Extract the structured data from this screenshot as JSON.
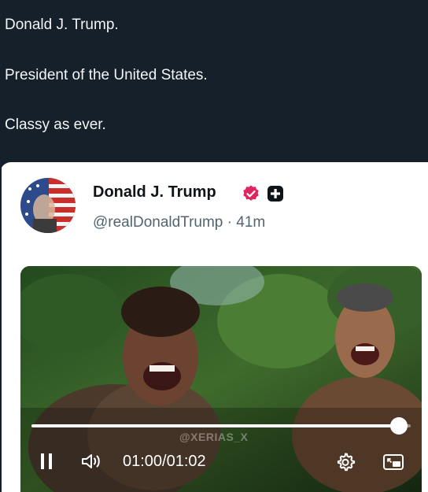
{
  "tweet": {
    "lines": [
      "Donald J. Trump.",
      "President of the United States.",
      "Classy as ever."
    ]
  },
  "quoted_post": {
    "author_name": "Donald J. Trump",
    "handle_time": "@realDonaldTrump · 41m",
    "badges": [
      "verified-icon",
      "plus-badge-icon"
    ],
    "colors": {
      "verified": "#e0245e",
      "name": "#0f1419",
      "handle": "#536471"
    }
  },
  "video": {
    "watermark": "@XERIAS_X",
    "time": "01:00/01:02",
    "progress": 0.968,
    "controls": [
      "pause-icon",
      "volume-icon",
      "settings-icon",
      "picture-in-picture-icon"
    ]
  }
}
